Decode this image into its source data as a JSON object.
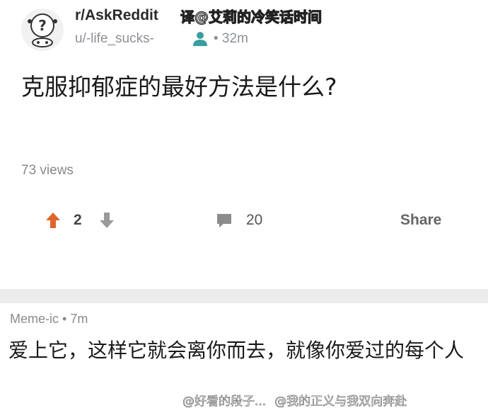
{
  "post": {
    "subreddit": "r/AskReddit",
    "translator_watermark": "译@艾莉的冷笑话时间",
    "user": "u/-life_sucks-",
    "age": "• 32m",
    "title": "克服抑郁症的最好方法是什么?",
    "views": "73 views",
    "upvotes": "2",
    "comments": "20",
    "share_label": "Share",
    "icons": [
      "reddit-snoo-icon",
      "person-icon",
      "upvote-arrow-icon",
      "downvote-arrow-icon",
      "comment-icon"
    ],
    "upvote_color": "#e0642b"
  },
  "comment": {
    "author": "Meme-ic",
    "age": "• 7m",
    "text": "爱上它，这样它就会离你而去，就像你爱过的每个人"
  },
  "weibo_watermark": {
    "left": "@好看的段子...",
    "right": "@我的正义与我双向奔赴"
  }
}
